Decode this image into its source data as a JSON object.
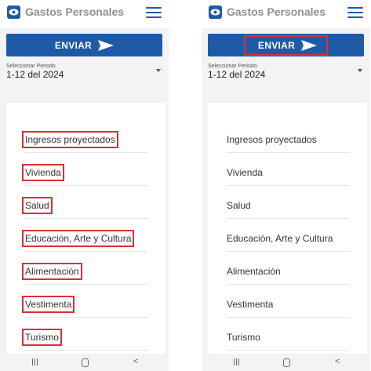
{
  "app": {
    "title": "Gastos Personales",
    "brand_color": "#1f5aa6"
  },
  "send_button": {
    "label": "ENVIAR"
  },
  "period": {
    "label": "Seleccionar Periodo",
    "value": "1-12 del 2024"
  },
  "categories": [
    "Ingresos proyectados",
    "Vivienda",
    "Salud",
    "Educación, Arte y Cultura",
    "Alimentación",
    "Vestimenta",
    "Turismo"
  ],
  "nav": {
    "back": "<"
  },
  "annotation": {
    "color": "#d9303a"
  }
}
